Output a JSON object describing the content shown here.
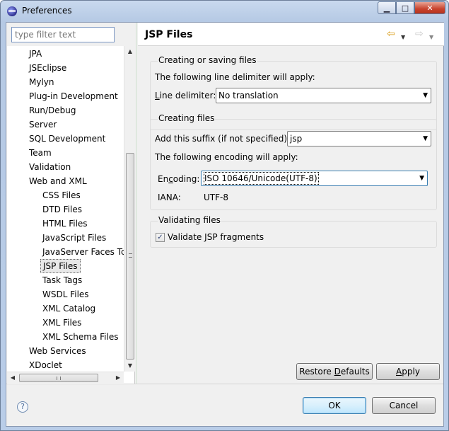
{
  "window": {
    "title": "Preferences",
    "minimize_label": "▁",
    "maximize_label": "□",
    "close_label": "✕"
  },
  "filter": {
    "placeholder": "type filter text"
  },
  "tree": {
    "items": [
      {
        "label": "JPA",
        "level": 1
      },
      {
        "label": "JSEclipse",
        "level": 1
      },
      {
        "label": "Mylyn",
        "level": 1
      },
      {
        "label": "Plug-in Development",
        "level": 1
      },
      {
        "label": "Run/Debug",
        "level": 1
      },
      {
        "label": "Server",
        "level": 1
      },
      {
        "label": "SQL Development",
        "level": 1
      },
      {
        "label": "Team",
        "level": 1
      },
      {
        "label": "Validation",
        "level": 1
      },
      {
        "label": "Web and XML",
        "level": 1
      },
      {
        "label": "CSS Files",
        "level": 2
      },
      {
        "label": "DTD Files",
        "level": 2
      },
      {
        "label": "HTML Files",
        "level": 2
      },
      {
        "label": "JavaScript Files",
        "level": 2
      },
      {
        "label": "JavaServer Faces Tc",
        "level": 2
      },
      {
        "label": "JSP Files",
        "level": 2,
        "selected": true
      },
      {
        "label": "Task Tags",
        "level": 2
      },
      {
        "label": "WSDL Files",
        "level": 2
      },
      {
        "label": "XML Catalog",
        "level": 2
      },
      {
        "label": "XML Files",
        "level": 2
      },
      {
        "label": "XML Schema Files",
        "level": 2
      },
      {
        "label": "Web Services",
        "level": 1
      },
      {
        "label": "XDoclet",
        "level": 1
      }
    ]
  },
  "page": {
    "title": "JSP Files",
    "creating_saving": {
      "title": "Creating or saving files",
      "delimiter_info": "The following line delimiter will apply:",
      "delimiter_label_pre": "",
      "delimiter_label_mnemonic": "L",
      "delimiter_label_post": "ine delimiter:",
      "delimiter_value": "No translation"
    },
    "creating": {
      "title": "Creating files",
      "suffix_label": "Add this suffix (if not specified):",
      "suffix_value": "jsp",
      "encoding_info": "The following encoding will apply:",
      "encoding_label_pre": "En",
      "encoding_label_mnemonic": "c",
      "encoding_label_post": "oding:",
      "encoding_value": "ISO 10646/Unicode(UTF-8)",
      "iana_label": "IANA:",
      "iana_value": "UTF-8"
    },
    "validating": {
      "title": "Validating files",
      "checkbox_label": "Validate JSP fragments",
      "checked_mark": "✓"
    },
    "restore_pre": "Restore ",
    "restore_mnemonic": "D",
    "restore_post": "efaults",
    "apply_pre": "",
    "apply_mnemonic": "A",
    "apply_post": "pply"
  },
  "footer": {
    "ok_label": "OK",
    "cancel_label": "Cancel",
    "help_label": "?"
  },
  "icons": {
    "back": "⇦",
    "forward": "⇨",
    "dropdown": "▼",
    "scroll_up": "▲",
    "scroll_down": "▼",
    "scroll_left": "◀",
    "scroll_right": "▶"
  }
}
